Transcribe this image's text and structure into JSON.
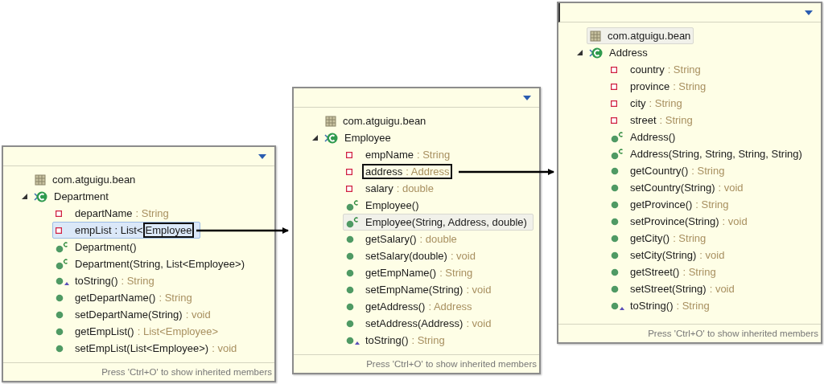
{
  "panels": [
    {
      "package": {
        "name": "com.atguigu.bean",
        "hovered": false
      },
      "class": {
        "name": "Department",
        "expanded": true
      },
      "members": [
        {
          "kind": "field",
          "name": "departName",
          "type": ": String",
          "selected": false,
          "hovered": false,
          "boxed": false
        },
        {
          "kind": "field",
          "name": "empList",
          "type": ": List<",
          "tail": "Employee",
          "selected": true,
          "hovered": false,
          "boxed": true
        },
        {
          "kind": "constructor",
          "name": "Department()",
          "selected": false,
          "hovered": false,
          "boxed": false
        },
        {
          "kind": "constructor",
          "name": "Department(String, List<Employee>)",
          "selected": false,
          "hovered": false,
          "boxed": false
        },
        {
          "kind": "override",
          "name": "toString()",
          "type": ": String",
          "selected": false,
          "hovered": false,
          "boxed": false
        },
        {
          "kind": "method",
          "name": "getDepartName()",
          "type": ": String",
          "selected": false,
          "hovered": false,
          "boxed": false
        },
        {
          "kind": "method",
          "name": "setDepartName(String)",
          "type": ": void",
          "selected": false,
          "hovered": false,
          "boxed": false
        },
        {
          "kind": "method",
          "name": "getEmpList()",
          "type": ": List<Employee>",
          "selected": false,
          "hovered": false,
          "boxed": false
        },
        {
          "kind": "method",
          "name": "setEmpList(List<Employee>)",
          "type": ": void",
          "selected": false,
          "hovered": false,
          "boxed": false
        }
      ],
      "footer": "Press 'Ctrl+O' to show inherited members"
    },
    {
      "package": {
        "name": "com.atguigu.bean",
        "hovered": false
      },
      "class": {
        "name": "Employee",
        "expanded": true
      },
      "members": [
        {
          "kind": "field",
          "name": "empName",
          "type": ": String",
          "selected": false,
          "hovered": false,
          "boxed": false
        },
        {
          "kind": "field",
          "name": "address",
          "type": ": Address",
          "selected": false,
          "hovered": false,
          "boxed": true
        },
        {
          "kind": "field",
          "name": "salary",
          "type": ": double",
          "selected": false,
          "hovered": false,
          "boxed": false
        },
        {
          "kind": "constructor",
          "name": "Employee()",
          "selected": false,
          "hovered": false,
          "boxed": false
        },
        {
          "kind": "constructor",
          "name": "Employee(String, Address, double)",
          "selected": false,
          "hovered": true,
          "boxed": false
        },
        {
          "kind": "method",
          "name": "getSalary()",
          "type": ": double",
          "selected": false,
          "hovered": false,
          "boxed": false
        },
        {
          "kind": "method",
          "name": "setSalary(double)",
          "type": ": void",
          "selected": false,
          "hovered": false,
          "boxed": false
        },
        {
          "kind": "method",
          "name": "getEmpName()",
          "type": ": String",
          "selected": false,
          "hovered": false,
          "boxed": false
        },
        {
          "kind": "method",
          "name": "setEmpName(String)",
          "type": ": void",
          "selected": false,
          "hovered": false,
          "boxed": false
        },
        {
          "kind": "method",
          "name": "getAddress()",
          "type": ": Address",
          "selected": false,
          "hovered": false,
          "boxed": false
        },
        {
          "kind": "method",
          "name": "setAddress(Address)",
          "type": ": void",
          "selected": false,
          "hovered": false,
          "boxed": false
        },
        {
          "kind": "override",
          "name": "toString()",
          "type": ": String",
          "selected": false,
          "hovered": false,
          "boxed": false
        }
      ],
      "footer": "Press 'Ctrl+O' to show inherited members"
    },
    {
      "package": {
        "name": "com.atguigu.bean",
        "hovered": true
      },
      "class": {
        "name": "Address",
        "expanded": true
      },
      "members": [
        {
          "kind": "field",
          "name": "country",
          "type": ": String",
          "selected": false,
          "hovered": false,
          "boxed": false
        },
        {
          "kind": "field",
          "name": "province",
          "type": ": String",
          "selected": false,
          "hovered": false,
          "boxed": false
        },
        {
          "kind": "field",
          "name": "city",
          "type": ": String",
          "selected": false,
          "hovered": false,
          "boxed": false
        },
        {
          "kind": "field",
          "name": "street",
          "type": ": String",
          "selected": false,
          "hovered": false,
          "boxed": false
        },
        {
          "kind": "constructor",
          "name": "Address()",
          "selected": false,
          "hovered": false,
          "boxed": false
        },
        {
          "kind": "constructor",
          "name": "Address(String, String, String, String)",
          "selected": false,
          "hovered": false,
          "boxed": false
        },
        {
          "kind": "method",
          "name": "getCountry()",
          "type": ": String",
          "selected": false,
          "hovered": false,
          "boxed": false
        },
        {
          "kind": "method",
          "name": "setCountry(String)",
          "type": ": void",
          "selected": false,
          "hovered": false,
          "boxed": false
        },
        {
          "kind": "method",
          "name": "getProvince()",
          "type": ": String",
          "selected": false,
          "hovered": false,
          "boxed": false
        },
        {
          "kind": "method",
          "name": "setProvince(String)",
          "type": ": void",
          "selected": false,
          "hovered": false,
          "boxed": false
        },
        {
          "kind": "method",
          "name": "getCity()",
          "type": ": String",
          "selected": false,
          "hovered": false,
          "boxed": false
        },
        {
          "kind": "method",
          "name": "setCity(String)",
          "type": ": void",
          "selected": false,
          "hovered": false,
          "boxed": false
        },
        {
          "kind": "method",
          "name": "getStreet()",
          "type": ": String",
          "selected": false,
          "hovered": false,
          "boxed": false
        },
        {
          "kind": "method",
          "name": "setStreet(String)",
          "type": ": void",
          "selected": false,
          "hovered": false,
          "boxed": false
        },
        {
          "kind": "override",
          "name": "toString()",
          "type": ": String",
          "selected": false,
          "hovered": false,
          "boxed": false
        }
      ],
      "footer": "Press 'Ctrl+O' to show inherited members"
    }
  ]
}
